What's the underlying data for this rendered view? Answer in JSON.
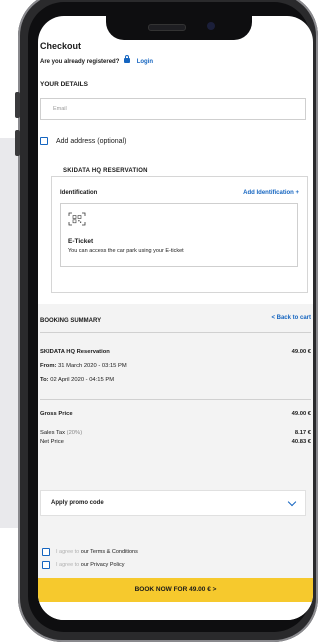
{
  "checkout": {
    "title": "Checkout",
    "registered_q": "Are you already registered?",
    "login": "Login"
  },
  "details": {
    "heading": "YOUR DETAILS",
    "email_placeholder": "Email",
    "add_address": "Add address (optional)"
  },
  "reservation": {
    "legend": "SKIDATA HQ RESERVATION",
    "identification": "Identification",
    "add_identification": "Add Identification +",
    "eticket_title": "E-Ticket",
    "eticket_desc": "You can access the car park using your E-ticket"
  },
  "summary": {
    "heading": "BOOKING SUMMARY",
    "back": "< Back to cart",
    "item_name": "SKIDATA HQ Reservation",
    "item_price": "49.00 €",
    "from_label": "From:",
    "from_value": "31 March 2020 - 03:15 PM",
    "to_label": "To:",
    "to_value": "02 April 2020 - 04:15 PM",
    "gross_label": "Gross Price",
    "gross_value": "49.00 €",
    "tax_label": "Sales Tax",
    "tax_rate": "(20%)",
    "tax_value": "8.17 €",
    "net_label": "Net Price",
    "net_value": "40.83 €",
    "promo": "Apply promo code"
  },
  "legal": {
    "agree": "I agree to",
    "terms": "our Terms & Conditions",
    "privacy": "our Privacy Policy"
  },
  "book": {
    "label": "BOOK NOW FOR 49.00 € >"
  },
  "colors": {
    "accent": "#1565c0",
    "cta": "#f6c92d",
    "summary_bg": "#f3f3f3"
  }
}
